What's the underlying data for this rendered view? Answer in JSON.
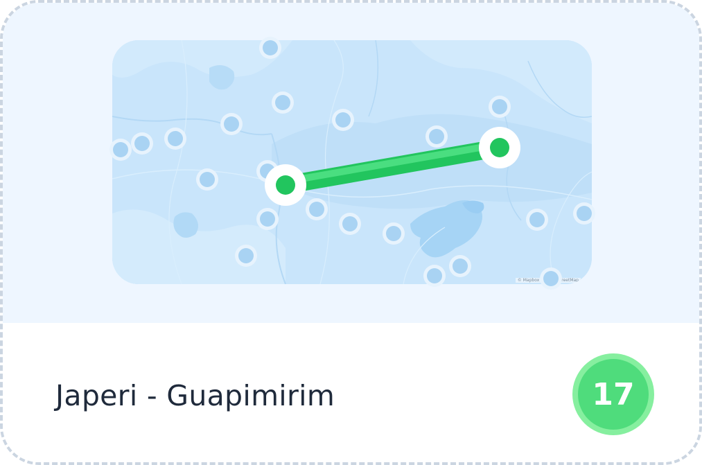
{
  "route": {
    "title": "Japeri - Guapimirim",
    "count": "17"
  },
  "map": {
    "attribution": "© Mapbox © OpenStreetMap",
    "colors": {
      "land": "#c9e5fb",
      "water": "#a6d4f5",
      "route": "#22c55e",
      "route_light": "#4ade80",
      "stop_dot": "#a9d3f3",
      "badge_outer": "#86ef9f",
      "badge_inner": "#4fdc7c"
    },
    "icons": {
      "route_start": "route-start-marker-icon",
      "route_end": "route-end-marker-icon",
      "stop": "stop-marker-icon"
    }
  }
}
